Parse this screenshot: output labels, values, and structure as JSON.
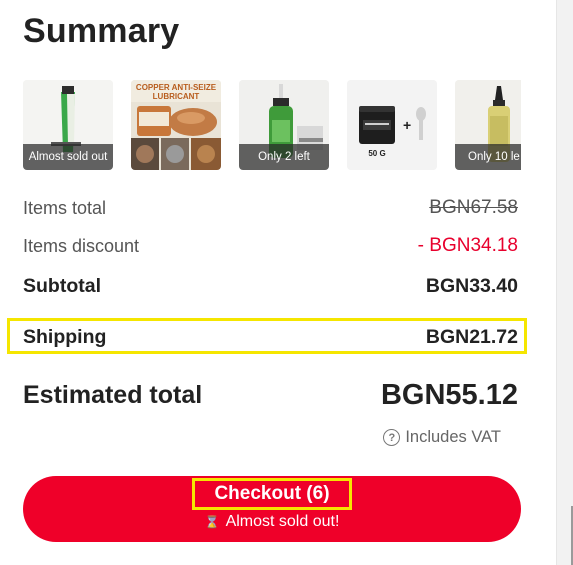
{
  "summary": {
    "title": "Summary",
    "products": [
      {
        "name": "product-thumb-green-tube",
        "badge": "Almost sold out"
      },
      {
        "name": "product-thumb-anti-seize",
        "badge": "",
        "image_text": "COPPER ANTI-SEIZE LUBRICANT"
      },
      {
        "name": "product-thumb-oil-bottle",
        "badge": "Only 2 left"
      },
      {
        "name": "product-thumb-grease-jar",
        "badge": "",
        "image_text": "50 G"
      },
      {
        "name": "product-thumb-yellow-bottle",
        "badge": "Only 10 le"
      }
    ],
    "items_total": {
      "label": "Items total",
      "value": "BGN67.58"
    },
    "items_discount": {
      "label": "Items discount",
      "value": "- BGN34.18"
    },
    "subtotal": {
      "label": "Subtotal",
      "value": "BGN33.40"
    },
    "shipping": {
      "label": "Shipping",
      "value": "BGN21.72"
    },
    "estimated_total": {
      "label": "Estimated total",
      "value": "BGN55.12"
    },
    "vat": {
      "label": "Includes VAT",
      "icon": "question-circle-icon"
    },
    "checkout": {
      "label": "Checkout (6)",
      "subtext": "Almost sold out!",
      "icon": "hourglass-icon"
    }
  },
  "colors": {
    "accent_red": "#ef0029",
    "discount_red": "#e8002d",
    "highlight_yellow": "#f5e600",
    "text_dark": "#222222",
    "text_muted": "#555555"
  }
}
